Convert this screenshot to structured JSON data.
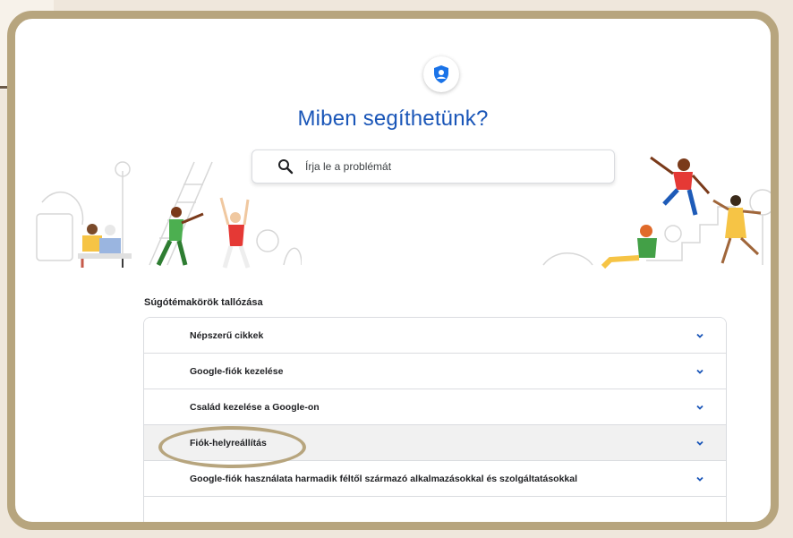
{
  "header": {
    "icon": "shield-person-icon",
    "title": "Miben segíthetünk?"
  },
  "search": {
    "placeholder": "Írja le a problémát",
    "icon": "search-icon"
  },
  "topics": {
    "heading": "Súgótémakörök tallózása",
    "items": [
      {
        "label": "Népszerű cikkek",
        "icon": "chevron-down-icon"
      },
      {
        "label": "Google-fiók kezelése",
        "icon": "chevron-down-icon"
      },
      {
        "label": "Család kezelése a Google-on",
        "icon": "chevron-down-icon"
      },
      {
        "label": "Fiók-helyreállítás",
        "icon": "chevron-down-icon",
        "highlighted": true
      },
      {
        "label": "Google-fiók használata harmadik féltől származó alkalmazásokkal és szolgáltatásokkal",
        "icon": "chevron-down-icon"
      }
    ]
  },
  "colors": {
    "accent": "#1a56b8",
    "frame": "#b7a57e",
    "highlight_row": "#f1f1f1"
  }
}
